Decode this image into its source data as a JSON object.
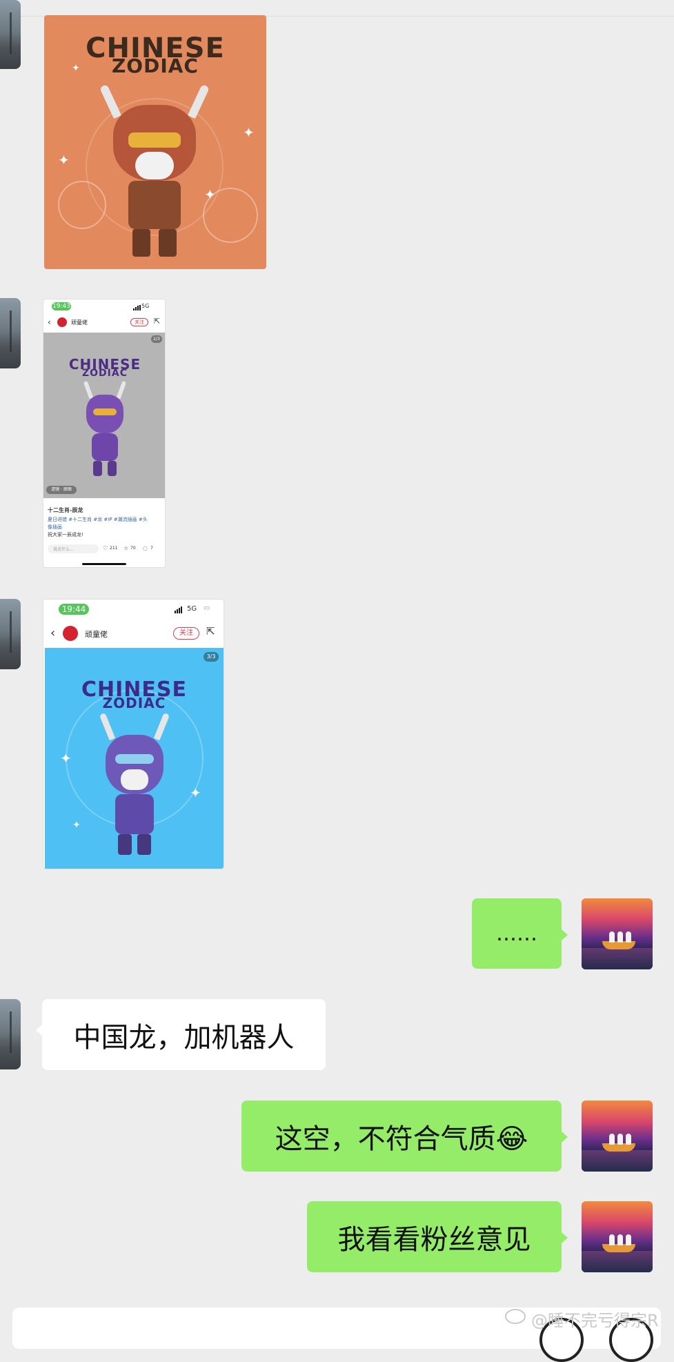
{
  "images": [
    {
      "title_line1": "CHINESE",
      "title_line2": "ZODIAC"
    },
    {
      "time": "19:43",
      "network": "5G",
      "account": "顽童佬",
      "follow": "关注",
      "counter": "2/3",
      "title_line1": "CHINESE",
      "title_line2": "ZODIAC",
      "badge": "滤镜 · 原图",
      "post_title": "十二生肖-辰龙",
      "tags_line1": "夏日进错 #十二生肖 #龙 #IP #潮流插画 #头",
      "tags_line2": "像插画",
      "caption": "祝大家一辰成龙!",
      "comment_placeholder": "说点什么...",
      "likes": "211",
      "stars": "70",
      "comments": "7"
    },
    {
      "time": "19:44",
      "network": "5G",
      "account": "顽童佬",
      "follow": "关注",
      "counter": "3/3",
      "title_line1": "CHINESE",
      "title_line2": "ZODIAC"
    }
  ],
  "messages": [
    {
      "side": "right",
      "text": "……"
    },
    {
      "side": "left",
      "text": "中国龙，加机器人"
    },
    {
      "side": "right",
      "text": "这空，不符合气质😂"
    },
    {
      "side": "right",
      "text": "我看看粉丝意见"
    }
  ],
  "watermark": "@睡不完亏得宗R",
  "colors": {
    "background": "#ededed",
    "sent_bubble": "#95ec69",
    "received_bubble": "#ffffff",
    "follow_red": "#e8394b",
    "status_green": "#55c65c",
    "orange_card": "#e2895d",
    "gray_card": "#b5b5b5",
    "blue_card": "#4fc0f3"
  }
}
